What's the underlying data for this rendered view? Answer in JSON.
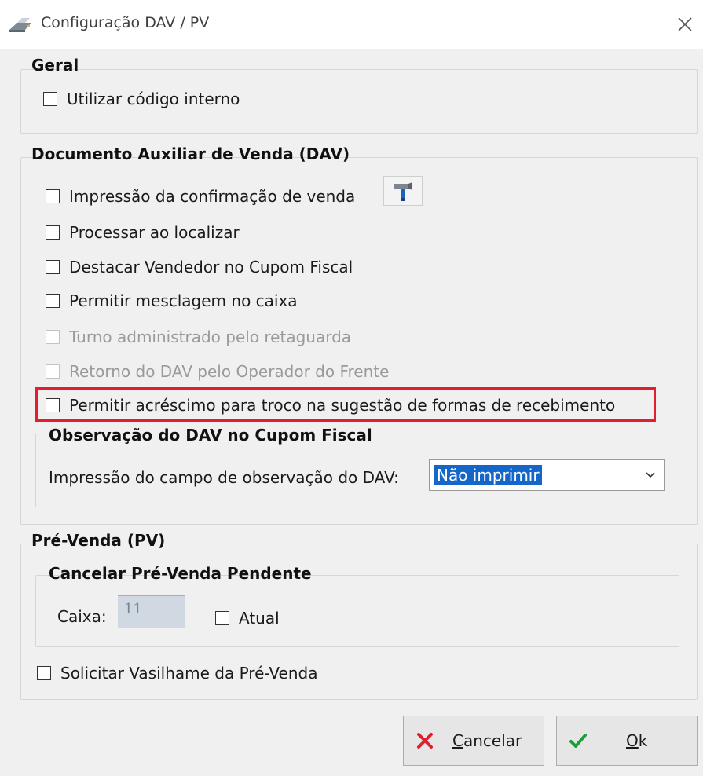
{
  "window": {
    "title": "Configuração DAV / PV",
    "icon": "printer-icon",
    "close_icon": "close-icon"
  },
  "geral": {
    "title": "Geral",
    "utilizar_codigo_interno": {
      "label": "Utilizar código interno",
      "checked": false
    }
  },
  "dav": {
    "title": "Documento Auxiliar de Venda (DAV)",
    "impressao_confirmacao": {
      "label": "Impressão da confirmação de venda",
      "checked": false,
      "tool_icon": "hammer-icon"
    },
    "processar_ao_localizar": {
      "label": "Processar ao localizar",
      "checked": false
    },
    "destacar_vendedor": {
      "label": "Destacar Vendedor no Cupom Fiscal",
      "checked": false
    },
    "permitir_mesclagem": {
      "label": "Permitir mesclagem no caixa",
      "checked": false
    },
    "turno_administrado": {
      "label": "Turno administrado pelo retaguarda",
      "checked": false,
      "enabled": false
    },
    "retorno_dav": {
      "label": "Retorno do DAV pelo Operador do Frente",
      "checked": false,
      "enabled": false
    },
    "permitir_acrescimo": {
      "label": "Permitir acréscimo para troco na sugestão de formas de recebimento",
      "checked": false,
      "highlight_color": "#e0202e"
    },
    "observacao": {
      "title": "Observação do DAV no Cupom Fiscal",
      "impressao_label": "Impressão do campo de observação do DAV:",
      "impressao_value": "Não imprimir"
    }
  },
  "pv": {
    "title": "Pré-Venda (PV)",
    "cancelar": {
      "title": "Cancelar Pré-Venda Pendente",
      "caixa_label": "Caixa:",
      "caixa_value": "11",
      "atual": {
        "label": "Atual",
        "checked": false
      }
    },
    "solicitar_vasilhame": {
      "label": "Solicitar Vasilhame da Pré-Venda",
      "checked": false
    }
  },
  "buttons": {
    "cancel": {
      "label": "Cancelar",
      "accel": "C",
      "rest": "ancelar",
      "icon": "x-icon",
      "color": "#e0202e"
    },
    "ok": {
      "label": "Ok",
      "accel": "O",
      "rest": "k",
      "icon": "checkmark-icon",
      "color": "#1e9e3a"
    }
  }
}
